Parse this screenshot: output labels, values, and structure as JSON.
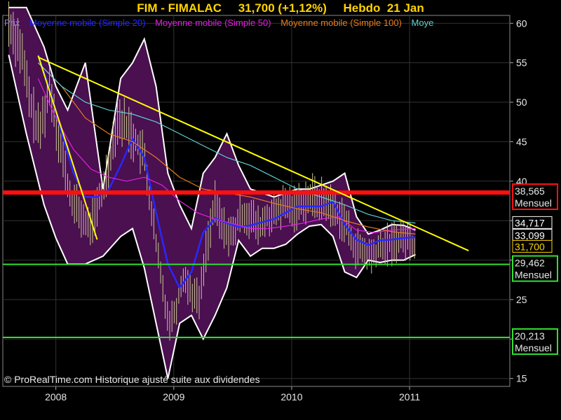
{
  "header": {
    "title": "FIM - FIMALAC",
    "price": "31,700 (+1,12%)",
    "period": "Hebdo",
    "date": "21 Jan"
  },
  "legend": {
    "price": {
      "label": "Prix",
      "color": "#9b7ac8"
    },
    "ma20": {
      "label": "Moyenne mobile (Simple 20)",
      "color": "#2828ff"
    },
    "ma50": {
      "label": "Moyenne mobile (Simple 50)",
      "color": "#e020e0"
    },
    "ma100": {
      "label": "Moyenne mobile (Simple 100)",
      "color": "#e87c1c"
    },
    "ma200": {
      "label": "Moye",
      "color": "#5fd0d0"
    }
  },
  "footer": "© ProRealTime.com Historique ajusté suite aux dividendes",
  "colors": {
    "background": "#000000",
    "bollinger_fill": "#4a1050",
    "bollinger_edge": "#ffffff",
    "candles": "#c8c890",
    "trendline": "#ffff00",
    "resistance": "#ff1010",
    "support": "#30e030",
    "axis_text": "#e8e8e8"
  },
  "chart_data": {
    "type": "line",
    "title": "FIM - FIMALAC",
    "ylim": [
      14,
      61
    ],
    "xlim": [
      2007.55,
      2011.85
    ],
    "y_ticks": [
      15,
      20,
      25,
      30,
      35,
      40,
      45,
      50,
      55,
      60
    ],
    "x_ticks": [
      {
        "value": 2008,
        "label": "2008"
      },
      {
        "value": 2009,
        "label": "2009"
      },
      {
        "value": 2010,
        "label": "2010"
      },
      {
        "value": 2011,
        "label": "2011"
      }
    ],
    "grid": true,
    "horizontal_levels": [
      {
        "value": 38.565,
        "label": "38,565",
        "sub": "Mensuel",
        "kind": "resistance"
      },
      {
        "value": 29.462,
        "label": "29,462",
        "sub": "Mensuel",
        "kind": "support"
      },
      {
        "value": 20.213,
        "label": "20,213",
        "sub": "Mensuel",
        "kind": "support"
      }
    ],
    "price_tags": [
      {
        "value": 34.717,
        "label": "34,717",
        "bg": "#000000",
        "fg": "#ffffff",
        "border": "#ffffff"
      },
      {
        "value": 33.099,
        "label": "33,099",
        "bg": "#000000",
        "fg": "#ffffff",
        "border": "#ffffff"
      },
      {
        "value": 31.7,
        "label": "31,700",
        "bg": "#000000",
        "fg": "#ffd400",
        "border": "#ffd400"
      }
    ],
    "trendlines": [
      {
        "x": [
          2007.85,
          2008.35
        ],
        "y": [
          55.9,
          32.6
        ]
      },
      {
        "x": [
          2007.85,
          2011.5
        ],
        "y": [
          55.7,
          31.2
        ]
      }
    ],
    "series": [
      {
        "name": "Moyenne mobile (Simple 20)",
        "key": "ma20",
        "width": 2.5,
        "x": [
          2007.85,
          2007.95,
          2008.05,
          2008.15,
          2008.25,
          2008.35,
          2008.45,
          2008.55,
          2008.65,
          2008.75,
          2008.85,
          2008.95,
          2009.05,
          2009.15,
          2009.25,
          2009.35,
          2009.45,
          2009.55,
          2009.65,
          2009.75,
          2009.85,
          2009.95,
          2010.05,
          2010.15,
          2010.25,
          2010.35,
          2010.45,
          2010.55,
          2010.65,
          2010.75,
          2010.85,
          2010.95,
          2011.05
        ],
        "y": [
          56,
          51.5,
          46,
          41,
          38,
          38,
          39,
          42,
          45.4,
          43,
          36,
          29.5,
          26.5,
          28.5,
          33.5,
          35.3,
          34.7,
          34.2,
          34.4,
          34.8,
          35.2,
          36,
          36.8,
          36.8,
          36.8,
          37.4,
          34.5,
          32.6,
          31.9,
          32.5,
          32.6,
          32.8,
          32.9
        ]
      },
      {
        "name": "Moyenne mobile (Simple 50)",
        "key": "ma50",
        "x": [
          2007.85,
          2008.0,
          2008.15,
          2008.3,
          2008.45,
          2008.6,
          2008.75,
          2008.9,
          2009.05,
          2009.2,
          2009.35,
          2009.5,
          2009.65,
          2009.8,
          2009.95,
          2010.1,
          2010.25,
          2010.4,
          2010.55,
          2010.7,
          2010.85,
          2011.05
        ],
        "y": [
          53,
          48,
          44,
          41.5,
          40.5,
          40,
          40.5,
          39.5,
          37.5,
          36,
          35.2,
          34.6,
          34,
          34,
          34.3,
          34.7,
          35.2,
          35.5,
          33.8,
          33.5,
          33.8,
          34
        ]
      },
      {
        "name": "Moyenne mobile (Simple 100)",
        "key": "ma100",
        "x": [
          2007.85,
          2008.05,
          2008.25,
          2008.45,
          2008.65,
          2008.85,
          2009.05,
          2009.25,
          2009.45,
          2009.65,
          2009.85,
          2010.05,
          2010.25,
          2010.45,
          2010.65,
          2010.85,
          2011.05
        ],
        "y": [
          55,
          52,
          48,
          46,
          45,
          43,
          40.5,
          39,
          38.5,
          38,
          37.2,
          36.5,
          36,
          35,
          34.2,
          33.6,
          33.3
        ]
      },
      {
        "name": "Moye",
        "key": "ma200",
        "x": [
          2007.85,
          2008.05,
          2008.25,
          2008.45,
          2008.65,
          2008.85,
          2009.05,
          2009.25,
          2009.45,
          2009.65,
          2009.85,
          2010.05,
          2010.25,
          2010.45,
          2010.65,
          2010.85,
          2011.05
        ],
        "y": [
          55,
          52,
          50,
          49,
          48.5,
          47.5,
          46,
          44.5,
          43,
          42,
          40.5,
          39,
          38,
          37,
          35.8,
          35,
          34.7
        ]
      }
    ],
    "bollinger": {
      "x": [
        2007.6,
        2007.75,
        2007.9,
        2008.0,
        2008.1,
        2008.25,
        2008.4,
        2008.55,
        2008.65,
        2008.75,
        2008.85,
        2008.95,
        2009.05,
        2009.15,
        2009.25,
        2009.35,
        2009.45,
        2009.55,
        2009.65,
        2009.75,
        2009.85,
        2009.95,
        2010.05,
        2010.15,
        2010.25,
        2010.35,
        2010.45,
        2010.55,
        2010.65,
        2010.75,
        2010.85,
        2010.95,
        2011.05
      ],
      "upper": [
        62,
        62,
        57,
        52,
        49,
        55,
        39,
        53,
        55,
        58,
        52,
        41,
        37,
        34,
        41,
        43,
        46,
        42,
        39,
        38.5,
        38,
        38.5,
        39,
        39,
        39.5,
        40,
        41,
        35.5,
        33.3,
        33.8,
        34.5,
        34.4,
        33.8
      ],
      "lower": [
        56,
        46,
        37,
        32.8,
        29.5,
        29.5,
        30.5,
        33,
        34,
        29,
        22,
        15,
        22,
        23,
        20,
        23,
        26.5,
        32.5,
        30.5,
        31.5,
        31.5,
        32,
        33.3,
        34.3,
        34.5,
        33,
        28.5,
        27.8,
        30,
        29.7,
        30,
        30,
        30.7
      ]
    },
    "price_path": {
      "x": [
        2007.6,
        2007.7,
        2007.78,
        2007.86,
        2007.95,
        2008.03,
        2008.12,
        2008.2,
        2008.28,
        2008.36,
        2008.45,
        2008.52,
        2008.6,
        2008.68,
        2008.75,
        2008.82,
        2008.9,
        2008.96,
        2009.02,
        2009.08,
        2009.15,
        2009.22,
        2009.28,
        2009.35,
        2009.42,
        2009.5,
        2009.57,
        2009.65,
        2009.72,
        2009.8,
        2009.88,
        2009.95,
        2010.02,
        2010.1,
        2010.18,
        2010.25,
        2010.32,
        2010.38,
        2010.45,
        2010.52,
        2010.6,
        2010.68,
        2010.75,
        2010.83,
        2010.9,
        2010.97,
        2011.05
      ],
      "y": [
        60,
        57,
        50,
        46,
        52,
        45,
        38,
        36,
        34,
        37,
        42,
        48,
        47,
        45,
        43,
        35,
        27,
        22,
        24,
        28,
        26,
        25,
        32,
        37,
        34,
        33,
        36,
        35.5,
        34,
        35.5,
        36,
        37,
        36.5,
        37.5,
        38,
        37.5,
        37,
        36,
        35,
        32,
        31,
        30.5,
        31.5,
        32,
        32.5,
        32.8,
        31.7
      ]
    }
  }
}
